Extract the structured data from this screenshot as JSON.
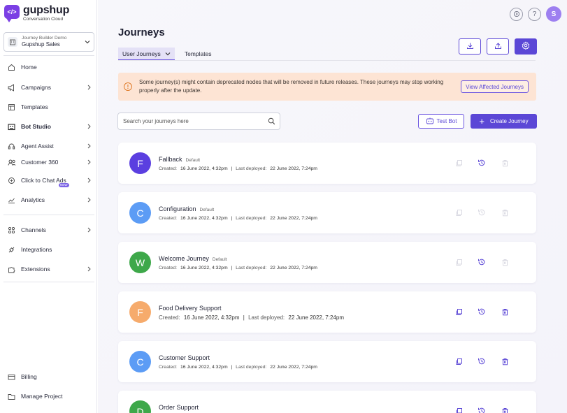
{
  "brand": {
    "name": "gupshup",
    "tagline": "Conversation Cloud",
    "mark": "</>"
  },
  "project": {
    "label": "Journey Builder Demo",
    "name": "Gupshup Sales"
  },
  "nav": {
    "home": "Home",
    "campaigns": "Campaigns",
    "templates": "Templates",
    "bot_studio": "Bot Studio",
    "agent_assist": "Agent Assist",
    "customer360": "Customer 360",
    "click_to_chat_ads": "Click to Chat Ads",
    "new_badge": "NEW",
    "analytics": "Analytics",
    "channels": "Channels",
    "integrations": "Integrations",
    "extensions": "Extensions",
    "billing": "Billing",
    "manage_project": "Manage Project"
  },
  "header": {
    "help": "?",
    "avatar_initial": "S"
  },
  "page": {
    "title": "Journeys",
    "tabs": {
      "user_journeys": "User Journeys",
      "templates": "Templates"
    }
  },
  "alert": {
    "text": "Some journey(s) might contain deprecated nodes that will be removed in future releases. These journeys may stop working properly after the update.",
    "button": "View Affected Journeys",
    "icon": "!"
  },
  "search": {
    "placeholder": "Search your journeys here"
  },
  "buttons": {
    "test_bot": "Test Bot",
    "create_journey": "Create Journey",
    "plus": "+"
  },
  "labels": {
    "created": "Created:",
    "last_deployed": "Last deployed:",
    "sep": "|"
  },
  "colors": {
    "accent": "#5b47d6",
    "alert_bg": "#fde4d4",
    "alert_icon": "#e07b28"
  },
  "journeys": [
    {
      "initial": "F",
      "name": "Fallback",
      "tag": "Default",
      "created": "16 June 2022, 4:32pm",
      "deployed": "22 June 2022, 7:24pm",
      "color": "#5b3fe0"
    },
    {
      "initial": "C",
      "name": "Configuration",
      "tag": "Default",
      "created": "16 June 2022, 4:32pm",
      "deployed": "22 June 2022, 7:24pm",
      "color": "#5c9cf5"
    },
    {
      "initial": "W",
      "name": "Welcome Journey",
      "tag": "Default",
      "created": "16 June 2022, 4:32pm",
      "deployed": "22 June 2022, 7:24pm",
      "color": "#3ea84a"
    },
    {
      "initial": "F",
      "name": "Food Delivery Support",
      "tag": "",
      "created": "16 June 2022, 4:32pm",
      "deployed": "22 June 2022, 7:24pm",
      "color": "#f6ab6c"
    },
    {
      "initial": "C",
      "name": "Customer Support",
      "tag": "",
      "created": "16 June 2022, 4:32pm",
      "deployed": "22 June 2022, 7:24pm",
      "color": "#5c9cf5"
    },
    {
      "initial": "D",
      "name": "Order Support",
      "tag": "",
      "created": "",
      "deployed": "",
      "color": "#3ea84a"
    }
  ]
}
